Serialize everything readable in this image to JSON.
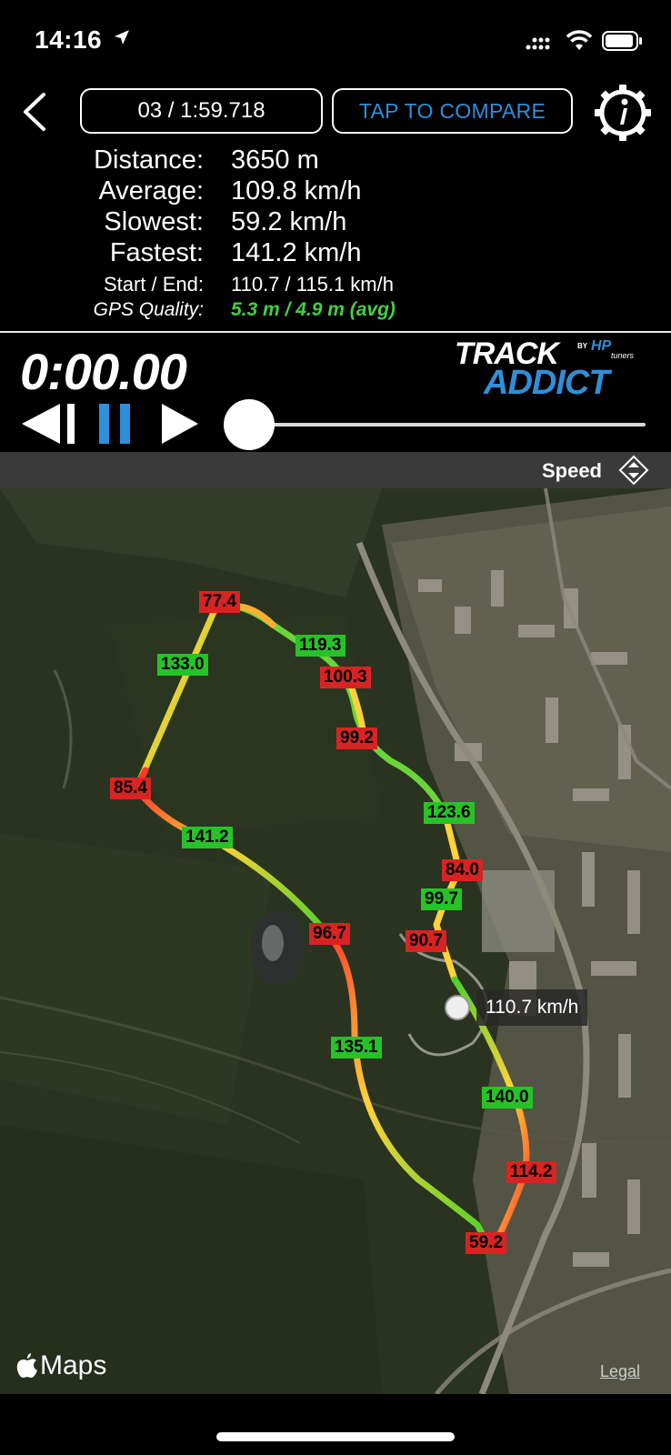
{
  "status_bar": {
    "time": "14:16"
  },
  "header": {
    "lap_selector": "03 / 1:59.718",
    "compare_button": "TAP TO COMPARE"
  },
  "stats": [
    {
      "label": "Distance:",
      "value": "3650 m"
    },
    {
      "label": "Average:",
      "value": "109.8 km/h"
    },
    {
      "label": "Slowest:",
      "value": "59.2 km/h"
    },
    {
      "label": "Fastest:",
      "value": "141.2 km/h"
    },
    {
      "label": "Start / End:",
      "value": "110.7 / 115.1 km/h"
    },
    {
      "label": "GPS Quality:",
      "value": "5.3 m / 4.9 m (avg)"
    }
  ],
  "playback": {
    "timer": "0:00.00",
    "progress": 0
  },
  "logo": {
    "track": "TRACK",
    "by": "BY",
    "hp": "HP",
    "tuners": "tuners",
    "addict": "ADDICT"
  },
  "map": {
    "mode_label": "Speed",
    "segment_labels": [
      {
        "text": "77.4",
        "kind": "slow"
      },
      {
        "text": "133.0",
        "kind": "fast"
      },
      {
        "text": "119.3",
        "kind": "fast"
      },
      {
        "text": "100.3",
        "kind": "slow"
      },
      {
        "text": "99.2",
        "kind": "slow"
      },
      {
        "text": "85.4",
        "kind": "slow"
      },
      {
        "text": "141.2",
        "kind": "fast"
      },
      {
        "text": "123.6",
        "kind": "fast"
      },
      {
        "text": "84.0",
        "kind": "slow"
      },
      {
        "text": "99.7",
        "kind": "fast"
      },
      {
        "text": "96.7",
        "kind": "slow"
      },
      {
        "text": "90.7",
        "kind": "slow"
      },
      {
        "text": "135.1",
        "kind": "fast"
      },
      {
        "text": "140.0",
        "kind": "fast"
      },
      {
        "text": "114.2",
        "kind": "slow"
      },
      {
        "text": "59.2",
        "kind": "slow"
      }
    ],
    "cursor_speed": "110.7 km/h",
    "credit": "Maps",
    "legal": "Legal"
  },
  "colors": {
    "accent_blue": "#2f8fd8",
    "gps_green": "#42d042",
    "slow_red": "#d92323",
    "fast_green": "#27c227"
  }
}
